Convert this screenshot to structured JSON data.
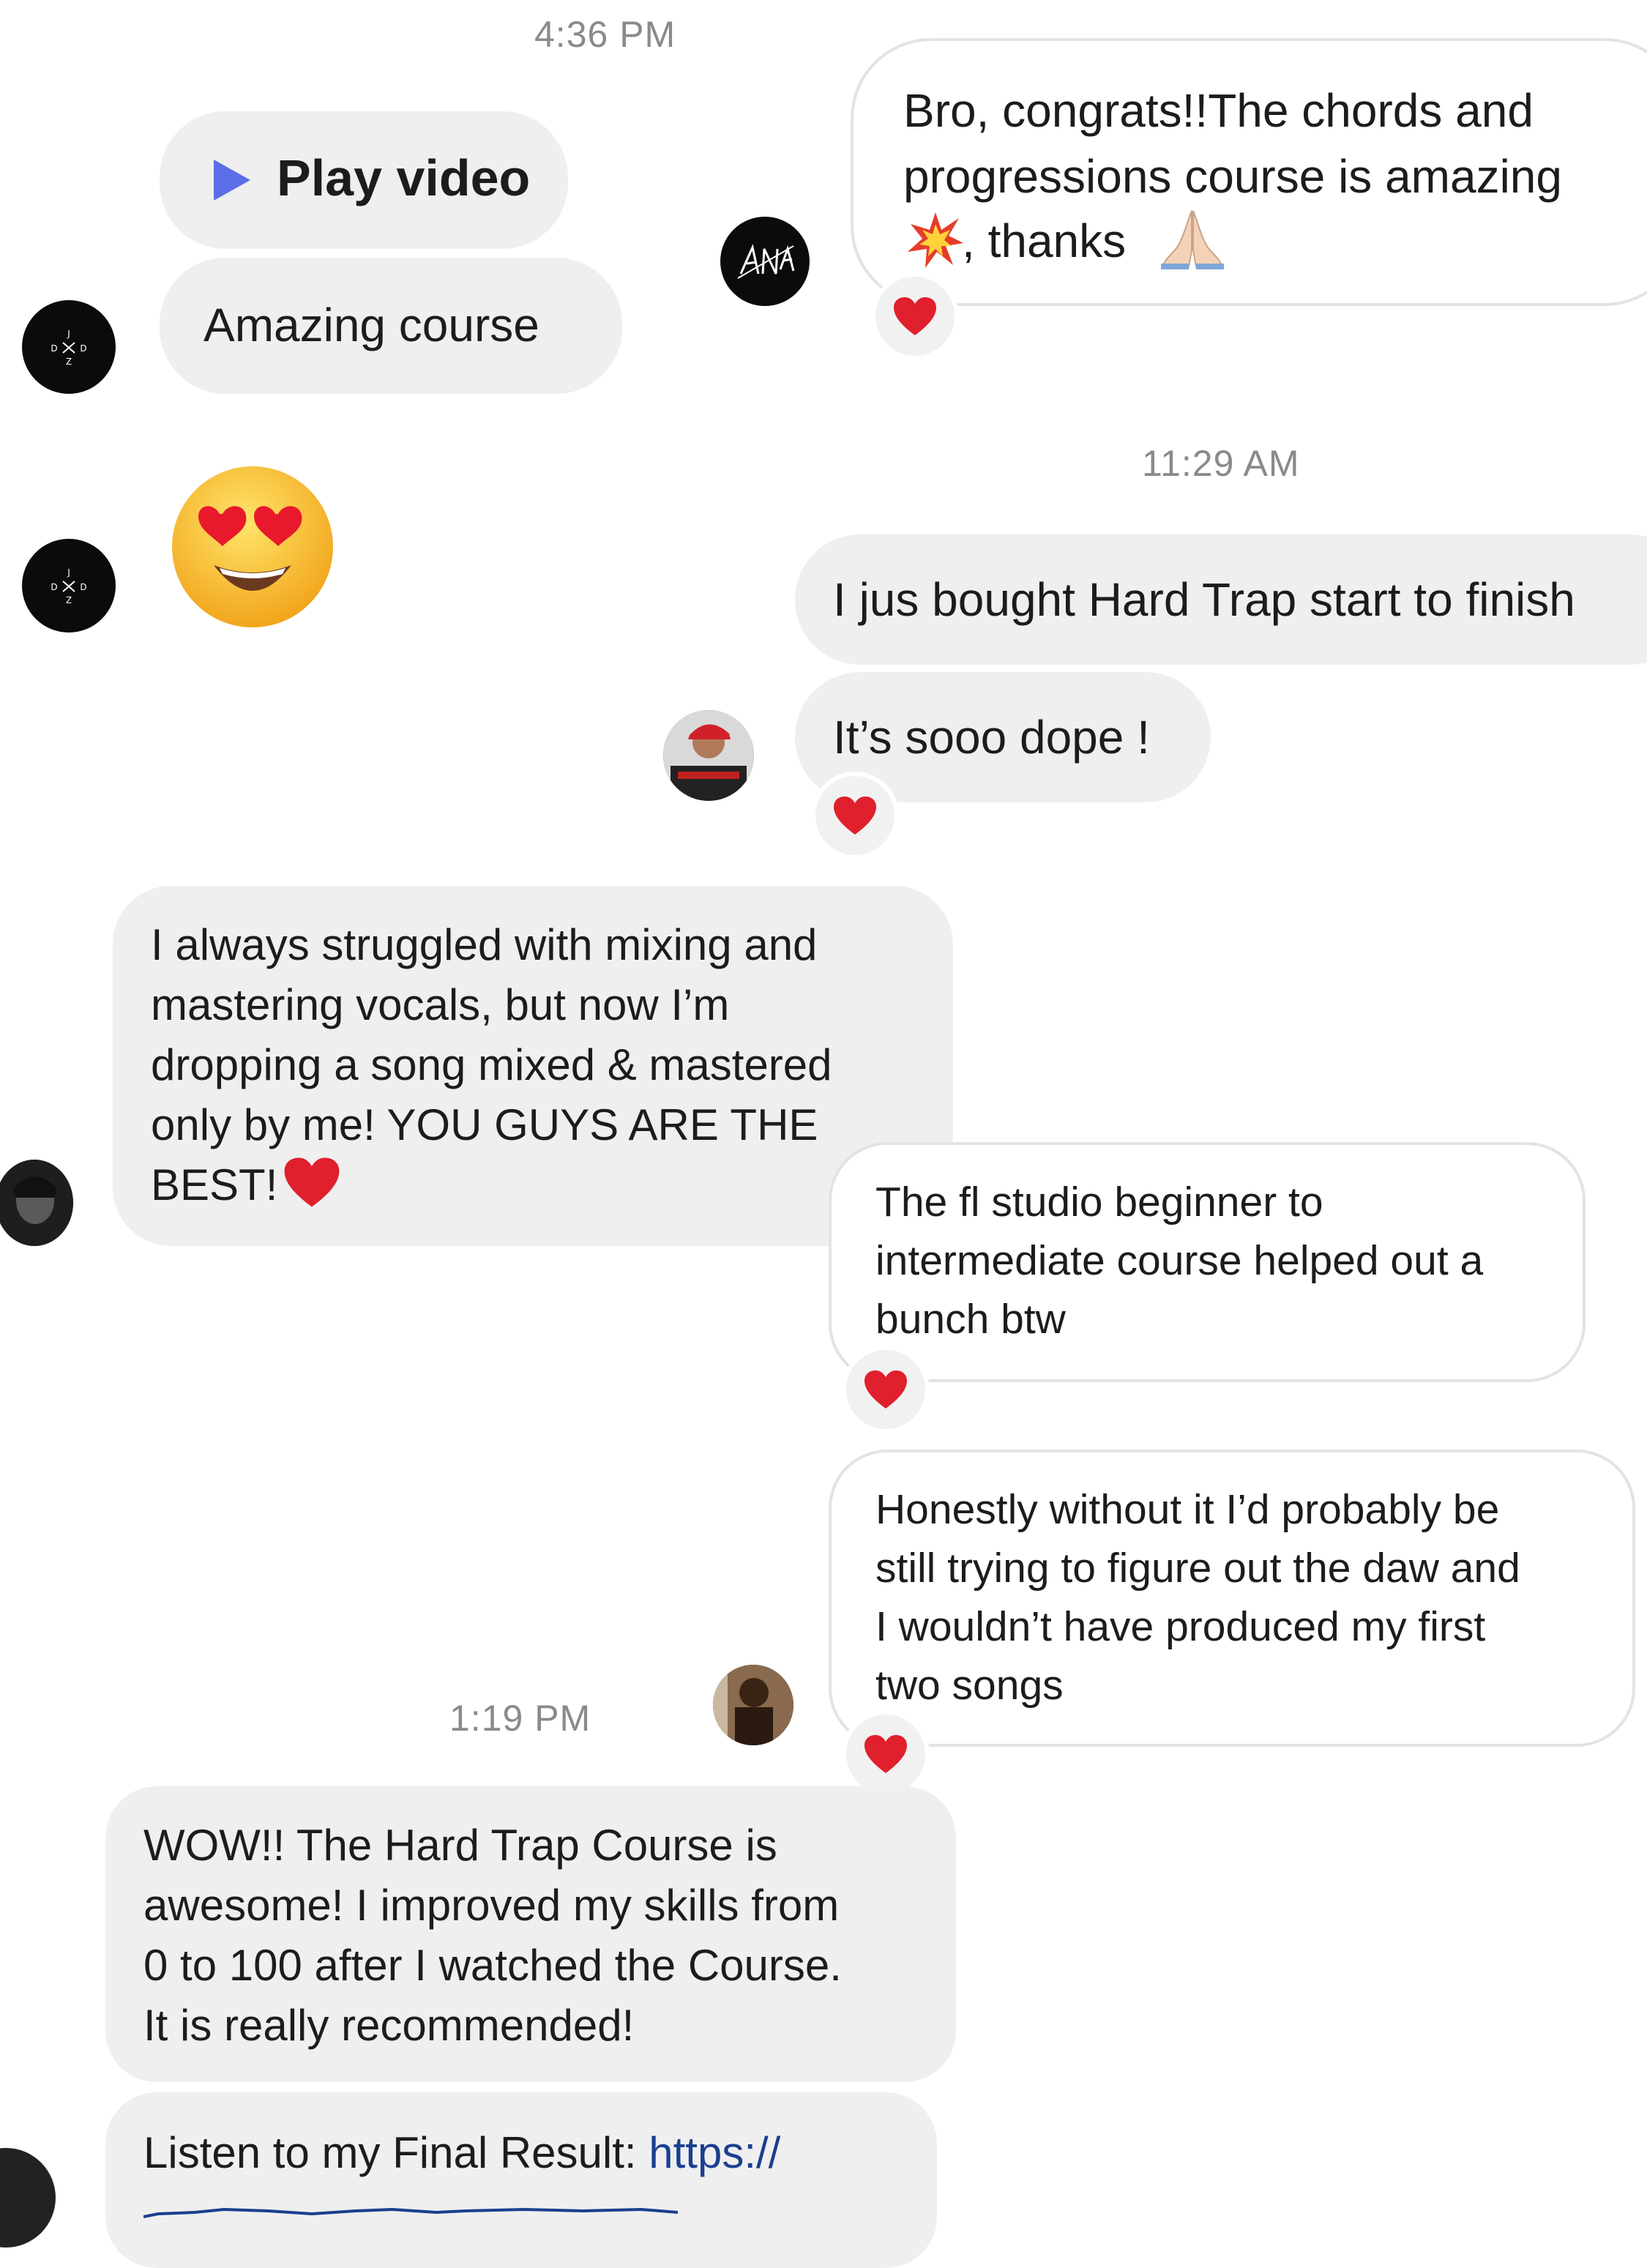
{
  "timestamps": [
    "4:36 PM",
    "11:29 AM",
    "1:19 PM"
  ],
  "messages": {
    "play_video": "Play video",
    "amazing_course": "Amazing course",
    "congrats": "Bro, congrats!!The chords and\nprogressions course is amazing",
    "thanks": ", thanks",
    "hard_trap_bought": "I jus bought Hard Trap start to finish",
    "sooo_dope": "It’s sooo dope !",
    "mixing": "I always struggled with mixing and\nmastering vocals, but now I’m\ndropping a song mixed & mastered\nonly by me! YOU GUYS ARE THE\nBEST!",
    "fl_studio": "The fl studio beginner to\nintermediate course helped out a\nbunch btw",
    "honestly": "Honestly without it I’d probably be\nstill trying to figure out the daw and\nI wouldn’t have produced my first\ntwo songs",
    "wow": "WOW!! The Hard Trap Course is\nawesome! I improved my skills from\n0 to 100 after I watched the Course.\nIt is really recommended!",
    "listen_prefix": "Listen to my Final Result: ",
    "listen_link": "https://"
  },
  "icons": {
    "play": "play-icon",
    "heart_reaction": "heart-icon",
    "heart_eyes": "heart-eyes-emoji",
    "collision": "collision-emoji",
    "praying_hands": "praying-hands-emoji"
  },
  "colors": {
    "play_icon": "#5b6ee8",
    "heart": "#e0202c",
    "bubble_in": "#efefef",
    "bubble_border": "#e3e3e3",
    "link": "#1a3f8f",
    "timestamp": "#8a8a8a"
  }
}
